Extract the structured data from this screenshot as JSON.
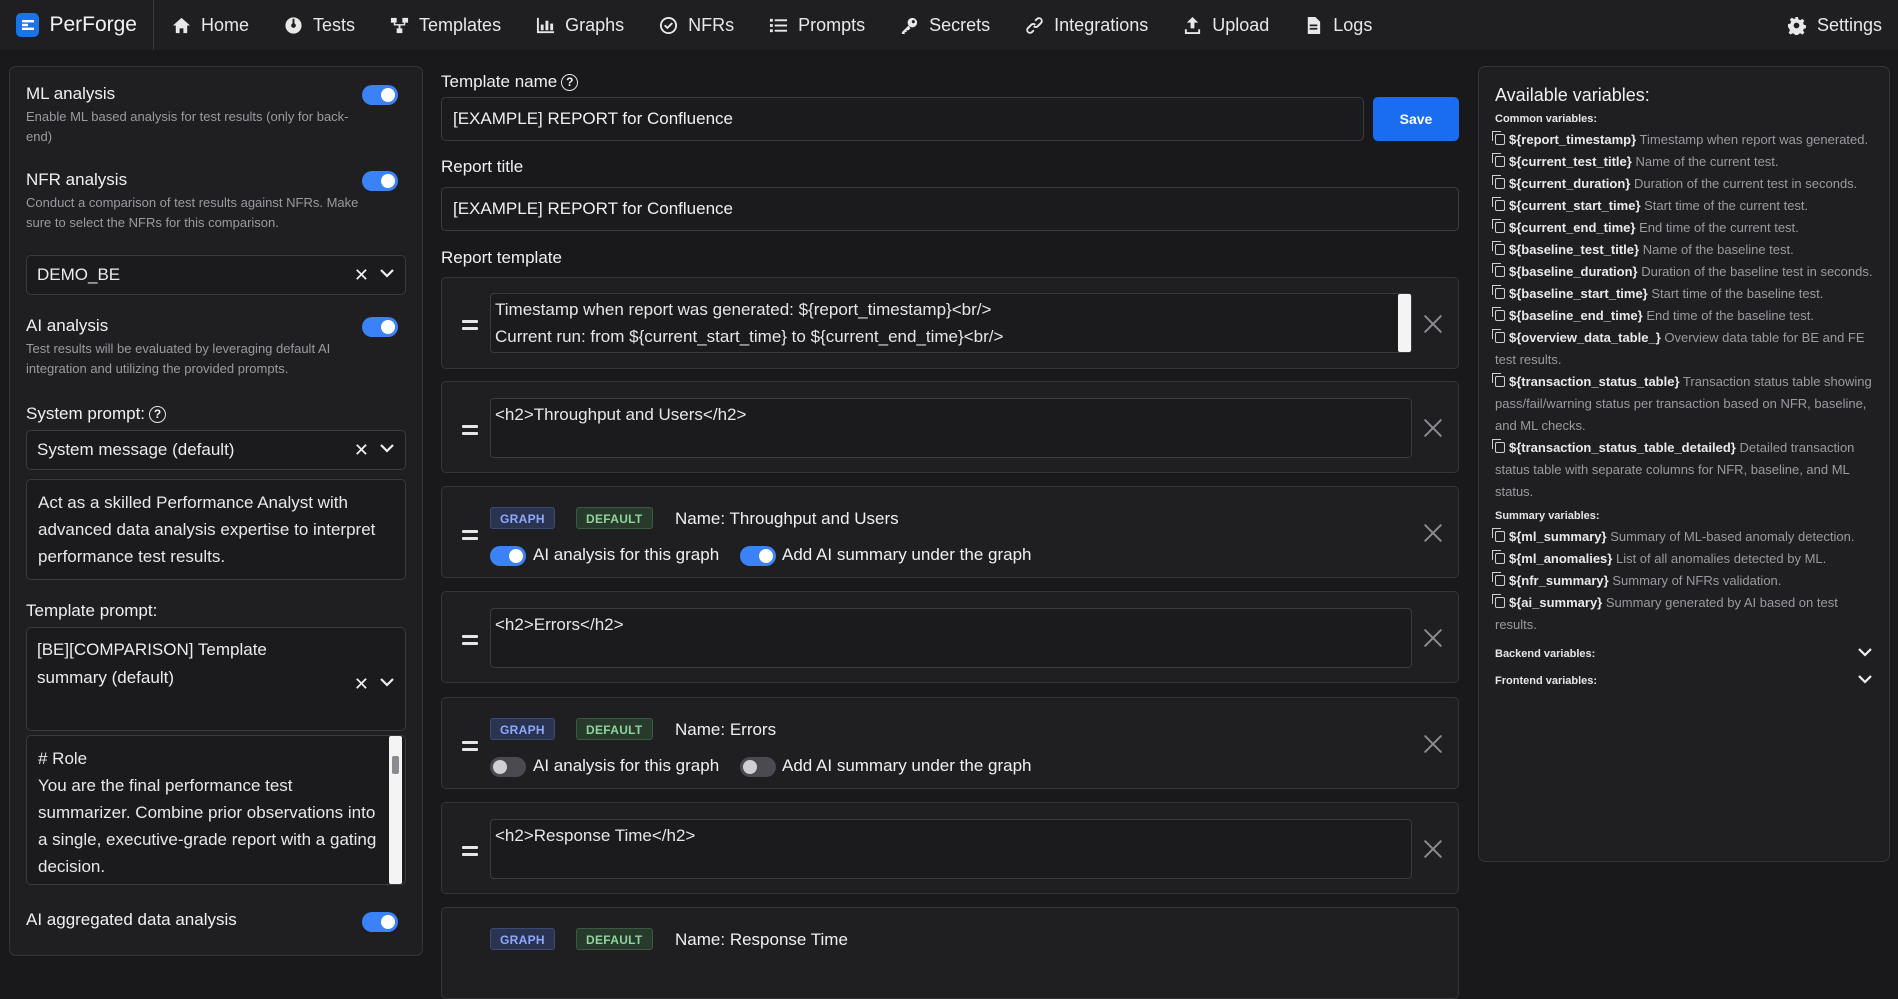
{
  "app": {
    "name": "PerForge"
  },
  "nav": {
    "items": [
      {
        "label": "Home",
        "icon": "home-icon"
      },
      {
        "label": "Tests",
        "icon": "tests-icon"
      },
      {
        "label": "Templates",
        "icon": "templates-icon"
      },
      {
        "label": "Graphs",
        "icon": "graphs-icon"
      },
      {
        "label": "NFRs",
        "icon": "nfrs-icon"
      },
      {
        "label": "Prompts",
        "icon": "prompts-icon"
      },
      {
        "label": "Secrets",
        "icon": "key-icon"
      },
      {
        "label": "Integrations",
        "icon": "link-icon"
      },
      {
        "label": "Upload",
        "icon": "upload-icon"
      },
      {
        "label": "Logs",
        "icon": "logs-icon"
      }
    ],
    "settings": "Settings"
  },
  "left": {
    "ml": {
      "title": "ML analysis",
      "desc": "Enable ML based analysis for test results (only for back-end)",
      "on": true
    },
    "nfr": {
      "title": "NFR analysis",
      "desc": "Conduct a comparison of test results against NFRs. Make sure to select the NFRs for this comparison.",
      "on": true,
      "selected": "DEMO_BE"
    },
    "ai": {
      "title": "AI analysis",
      "desc": "Test results will be evaluated by leveraging default AI integration and utilizing the provided prompts.",
      "on": true
    },
    "system_prompt": {
      "label": "System prompt:",
      "selected": "System message (default)",
      "text": "Act as a skilled Performance Analyst with advanced data analysis expertise to interpret performance test results."
    },
    "template_prompt": {
      "label": "Template prompt:",
      "selected": "[BE][COMPARISON] Template summary (default)",
      "text_lines": [
        "# Role",
        "You are the final performance test summarizer. Combine prior observations into a single, executive-grade report with a gating decision."
      ]
    },
    "aggregated": {
      "title": "AI aggregated data analysis",
      "on": true
    }
  },
  "main": {
    "template_name_label": "Template name",
    "template_name": "[EXAMPLE] REPORT for Confluence",
    "save_label": "Save",
    "report_title_label": "Report title",
    "report_title": "[EXAMPLE] REPORT for Confluence",
    "report_template_label": "Report template",
    "blocks": [
      {
        "type": "text",
        "lines": [
          "Timestamp when report was generated: ${report_timestamp}<br/>",
          "Current run: from ${current_start_time} to ${current_end_time}<br/>"
        ]
      },
      {
        "type": "text",
        "lines": [
          "<h2>Throughput and Users</h2>"
        ]
      },
      {
        "type": "graph",
        "badge_graph": "GRAPH",
        "badge_default": "DEFAULT",
        "name_label": "Name:",
        "name": "Throughput and Users",
        "ai_label": "AI analysis for this graph",
        "ai_on": true,
        "summary_label": "Add AI summary under the graph",
        "summary_on": true
      },
      {
        "type": "text",
        "lines": [
          "<h2>Errors</h2>"
        ]
      },
      {
        "type": "graph",
        "badge_graph": "GRAPH",
        "badge_default": "DEFAULT",
        "name_label": "Name:",
        "name": "Errors",
        "ai_label": "AI analysis for this graph",
        "ai_on": false,
        "summary_label": "Add AI summary under the graph",
        "summary_on": false
      },
      {
        "type": "text",
        "lines": [
          "<h2>Response Time</h2>"
        ]
      },
      {
        "type": "graph",
        "badge_graph": "GRAPH",
        "badge_default": "DEFAULT",
        "name_label": "Name:",
        "name": "Response Time"
      }
    ]
  },
  "vars": {
    "title": "Available variables:",
    "common_label": "Common variables:",
    "common": [
      {
        "name": "${report_timestamp}",
        "desc": "Timestamp when report was generated."
      },
      {
        "name": "${current_test_title}",
        "desc": "Name of the current test."
      },
      {
        "name": "${current_duration}",
        "desc": "Duration of the current test in seconds."
      },
      {
        "name": "${current_start_time}",
        "desc": "Start time of the current test."
      },
      {
        "name": "${current_end_time}",
        "desc": "End time of the current test."
      },
      {
        "name": "${baseline_test_title}",
        "desc": "Name of the baseline test."
      },
      {
        "name": "${baseline_duration}",
        "desc": "Duration of the baseline test in seconds."
      },
      {
        "name": "${baseline_start_time}",
        "desc": "Start time of the baseline test."
      },
      {
        "name": "${baseline_end_time}",
        "desc": "End time of the baseline test."
      },
      {
        "name": "${overview_data_table_}",
        "desc": "Overview data table for BE and FE test results."
      },
      {
        "name": "${transaction_status_table}",
        "desc": "Transaction status table showing pass/fail/warning status per transaction based on NFR, baseline, and ML checks."
      },
      {
        "name": "${transaction_status_table_detailed}",
        "desc": "Detailed transaction status table with separate columns for NFR, baseline, and ML status."
      }
    ],
    "summary_label": "Summary variables:",
    "summary": [
      {
        "name": "${ml_summary}",
        "desc": "Summary of ML-based anomaly detection."
      },
      {
        "name": "${ml_anomalies}",
        "desc": "List of all anomalies detected by ML."
      },
      {
        "name": "${nfr_summary}",
        "desc": "Summary of NFRs validation."
      },
      {
        "name": "${ai_summary}",
        "desc": "Summary generated by AI based on test results."
      }
    ],
    "backend_label": "Backend variables:",
    "frontend_label": "Frontend variables:"
  },
  "colors": {
    "accent": "#1a6cf0",
    "toggle_on": "#3b82f6",
    "background": "#19191c",
    "panel": "#1f1f22"
  }
}
